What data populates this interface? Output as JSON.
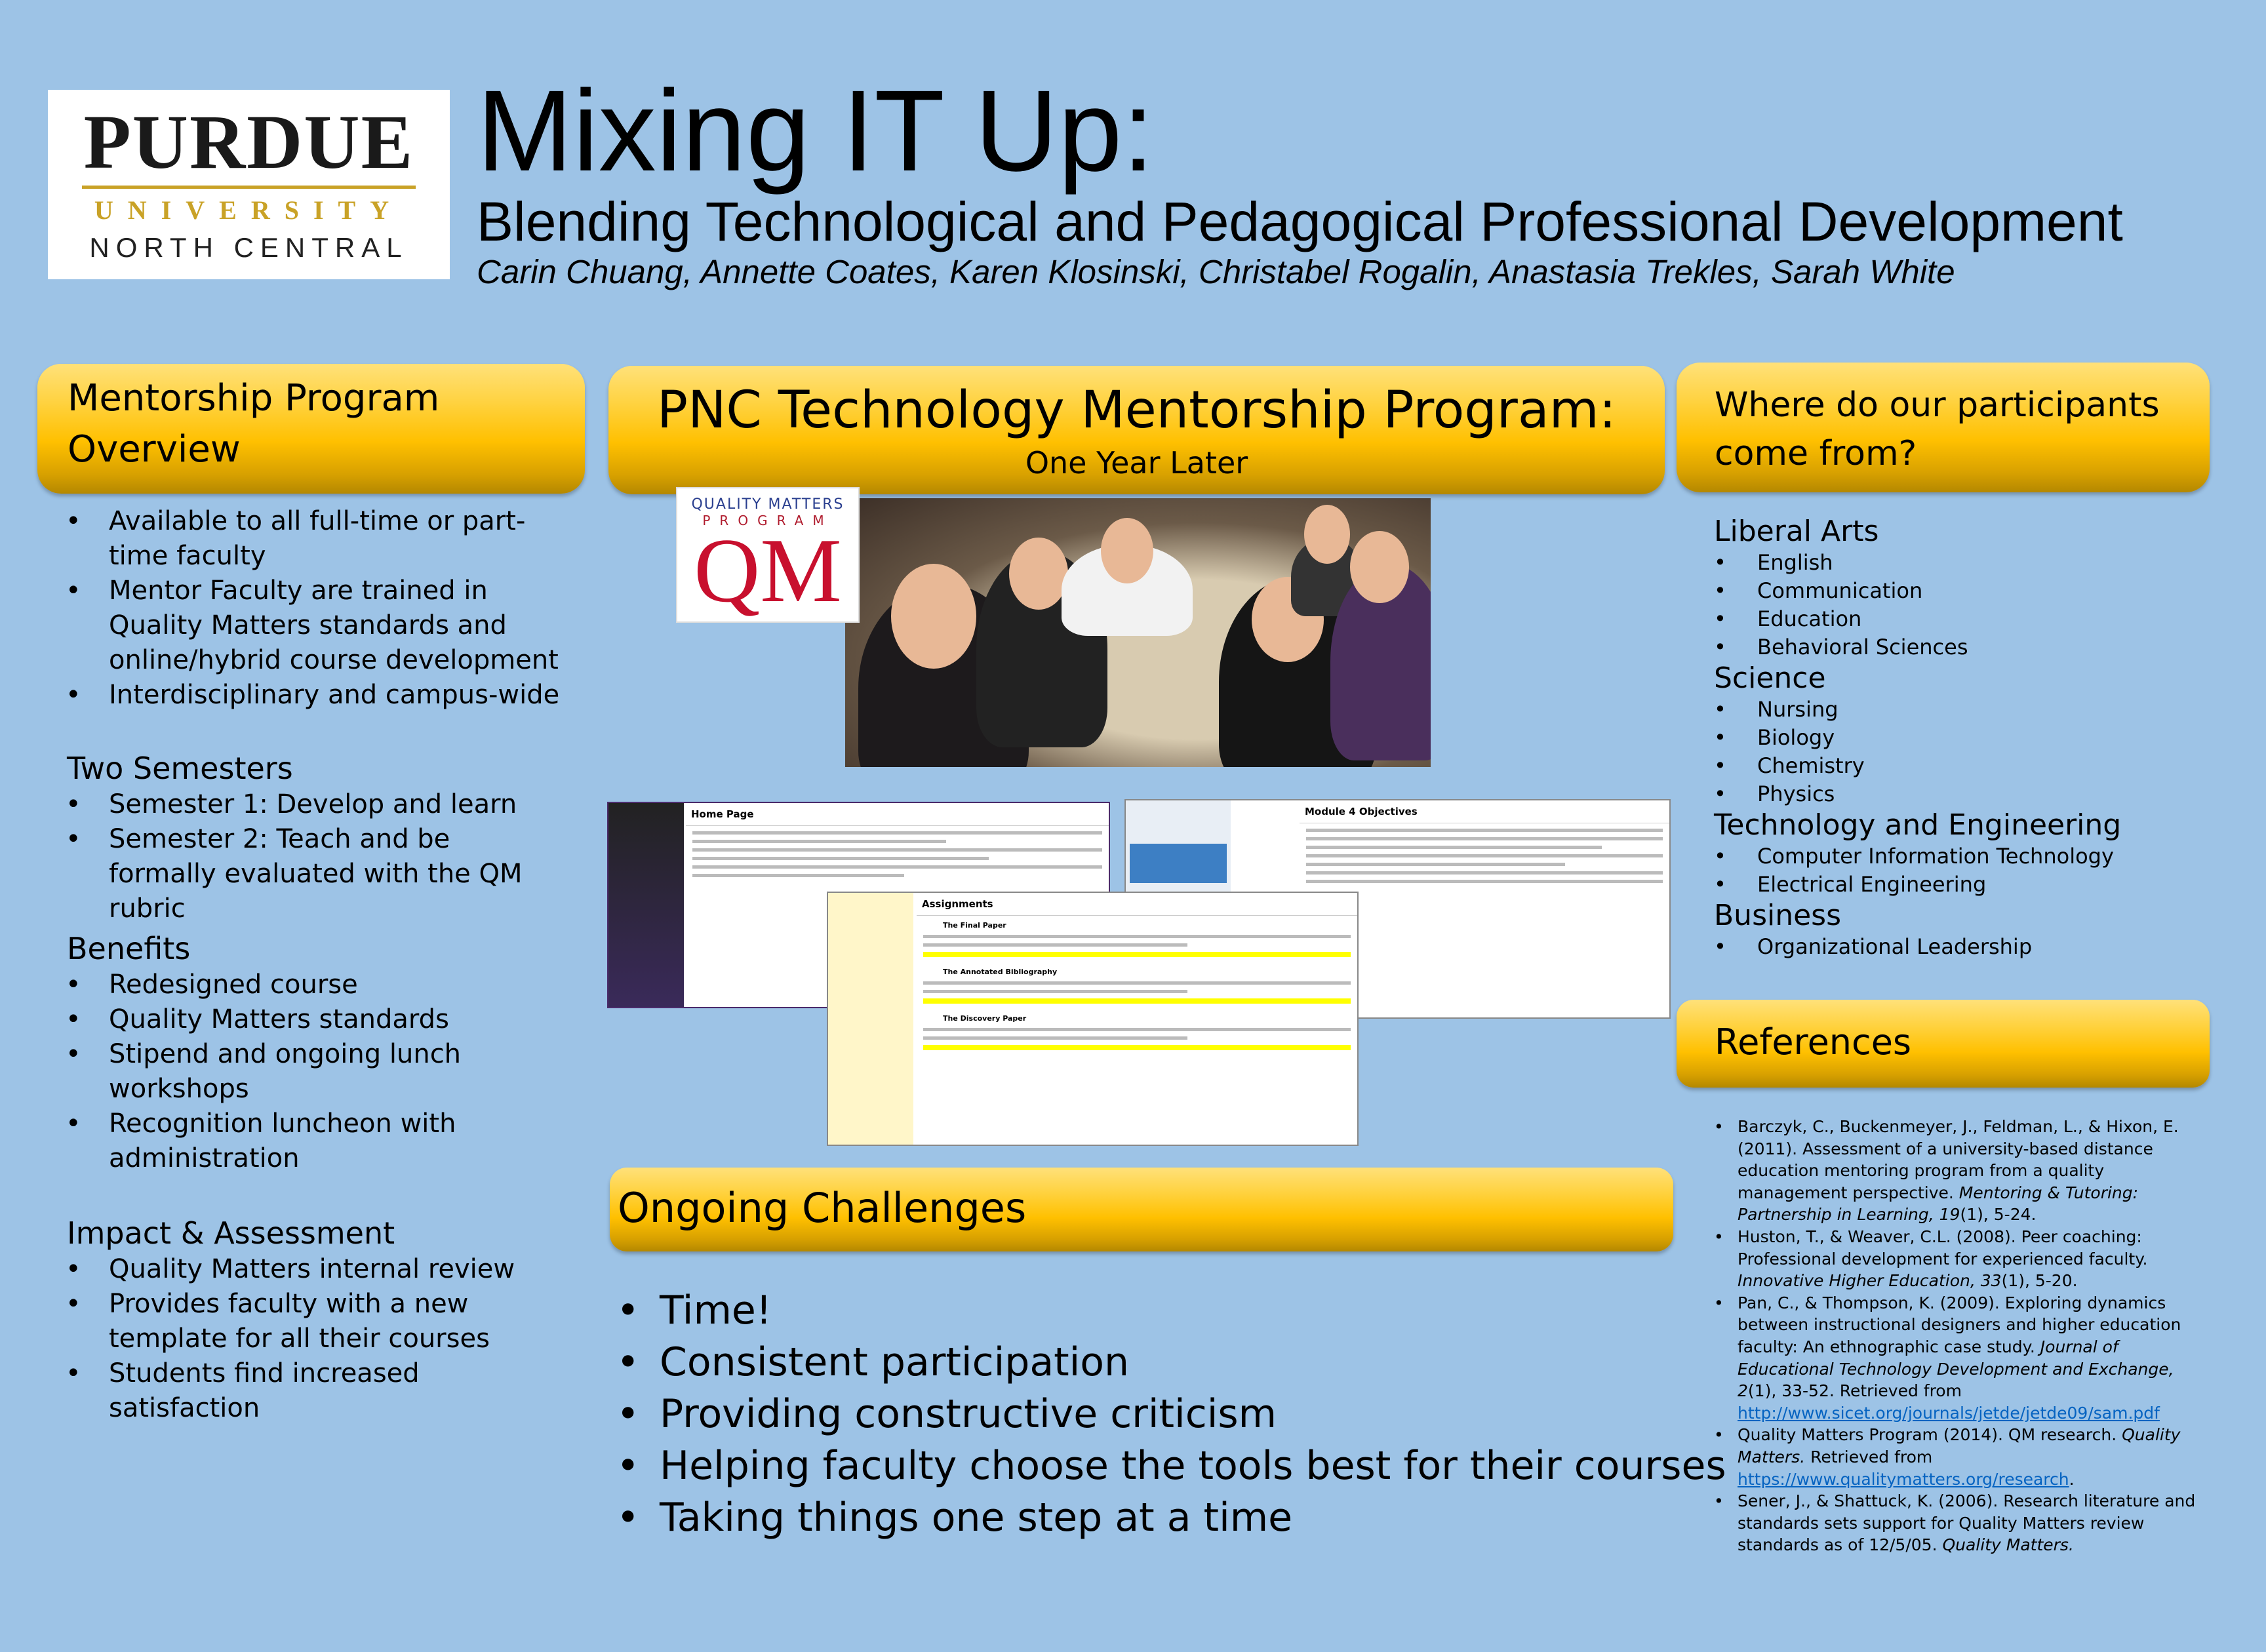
{
  "logo": {
    "line1": "PURDUE",
    "line2": "UNIVERSITY",
    "line3": "NORTH CENTRAL"
  },
  "header": {
    "title": "Mixing IT Up:",
    "subtitle": "Blending Technological and Pedagogical Professional Development",
    "authors": "Carin Chuang, Annette Coates, Karen Klosinski, Christabel Rogalin, Anastasia Trekles, Sarah White"
  },
  "left": {
    "header_line1": "Mentorship Program",
    "header_line2": "Overview",
    "intro": [
      "Available to all full-time or part-time faculty",
      "Mentor Faculty are trained in Quality Matters standards and online/hybrid course development",
      "Interdisciplinary and campus-wide"
    ],
    "semesters": {
      "title": "Two Semesters",
      "items": [
        "Semester 1: Develop and learn",
        "Semester 2: Teach and be formally evaluated with the QM rubric"
      ]
    },
    "benefits": {
      "title": "Benefits",
      "items": [
        "Redesigned course",
        "Quality Matters standards",
        "Stipend and ongoing lunch workshops",
        "Recognition luncheon with administration"
      ]
    },
    "impact": {
      "title": "Impact & Assessment",
      "items": [
        "Quality Matters internal review",
        "Provides faculty with a new template for all their courses",
        "Students find increased satisfaction"
      ]
    }
  },
  "center": {
    "header_title": "PNC Technology Mentorship Program:",
    "header_subtitle": "One Year Later",
    "qm_logo": {
      "line1": "QUALITY MATTERS",
      "line2": "PROGRAM",
      "mark": "QM"
    },
    "screens": {
      "s1_title": "Home Page",
      "s2_title": "Module 4 Objectives",
      "s3_title": "Assignments",
      "s3_items": [
        "The Final Paper",
        "The Annotated Bibliography",
        "The Discovery Paper"
      ]
    },
    "challenges": {
      "title": "Ongoing Challenges",
      "items": [
        "Time!",
        "Consistent participation",
        "Providing constructive criticism",
        "Helping faculty choose the tools best for their courses",
        "Taking things one step at a time"
      ]
    }
  },
  "right": {
    "header_line1": "Where do our participants",
    "header_line2": "come from?",
    "groups": [
      {
        "name": "Liberal Arts",
        "items": [
          "English",
          "Communication",
          "Education",
          "Behavioral Sciences"
        ]
      },
      {
        "name": "Science",
        "items": [
          "Nursing",
          "Biology",
          "Chemistry",
          "Physics"
        ]
      },
      {
        "name": "Technology and Engineering",
        "items": [
          "Computer Information Technology",
          "Electrical Engineering"
        ]
      },
      {
        "name": "Business",
        "items": [
          "Organizational Leadership"
        ]
      }
    ],
    "references_title": "References",
    "references": [
      {
        "text": "Barczyk, C., Buckenmeyer, J., Feldman, L., & Hixon, E. (2011). Assessment of a university-based distance education mentoring program from a quality management perspective. ",
        "italic": "Mentoring & Tutoring: Partnership in Learning, 19",
        "tail": "(1), 5-24.",
        "link": ""
      },
      {
        "text": "Huston, T., & Weaver, C.L. (2008). Peer coaching: Professional development for experienced faculty. ",
        "italic": "Innovative Higher Education, 33",
        "tail": "(1), 5-20.",
        "link": ""
      },
      {
        "text": "Pan, C., & Thompson, K. (2009). Exploring dynamics between instructional designers and higher education faculty: An ethnographic case study. ",
        "italic": "Journal of Educational Technology Development and Exchange, 2",
        "tail": "(1), 33-52. Retrieved from ",
        "link": "http://www.sicet.org/journals/jetde/jetde09/sam.pdf"
      },
      {
        "text": "Quality Matters Program (2014). QM research. ",
        "italic": "Quality Matters.",
        "tail": " Retrieved from ",
        "link": "https://www.qualitymatters.org/research"
      },
      {
        "text": "Sener, J., & Shattuck, K. (2006). Research literature and standards sets support for Quality Matters review standards as of 12/5/05. ",
        "italic": "Quality Matters.",
        "tail": "",
        "link": ""
      }
    ]
  },
  "colors": {
    "background": "#9dc3e6",
    "header_gold": "#ffc000",
    "purdue_gold": "#c9a227",
    "link": "#0563c1"
  }
}
